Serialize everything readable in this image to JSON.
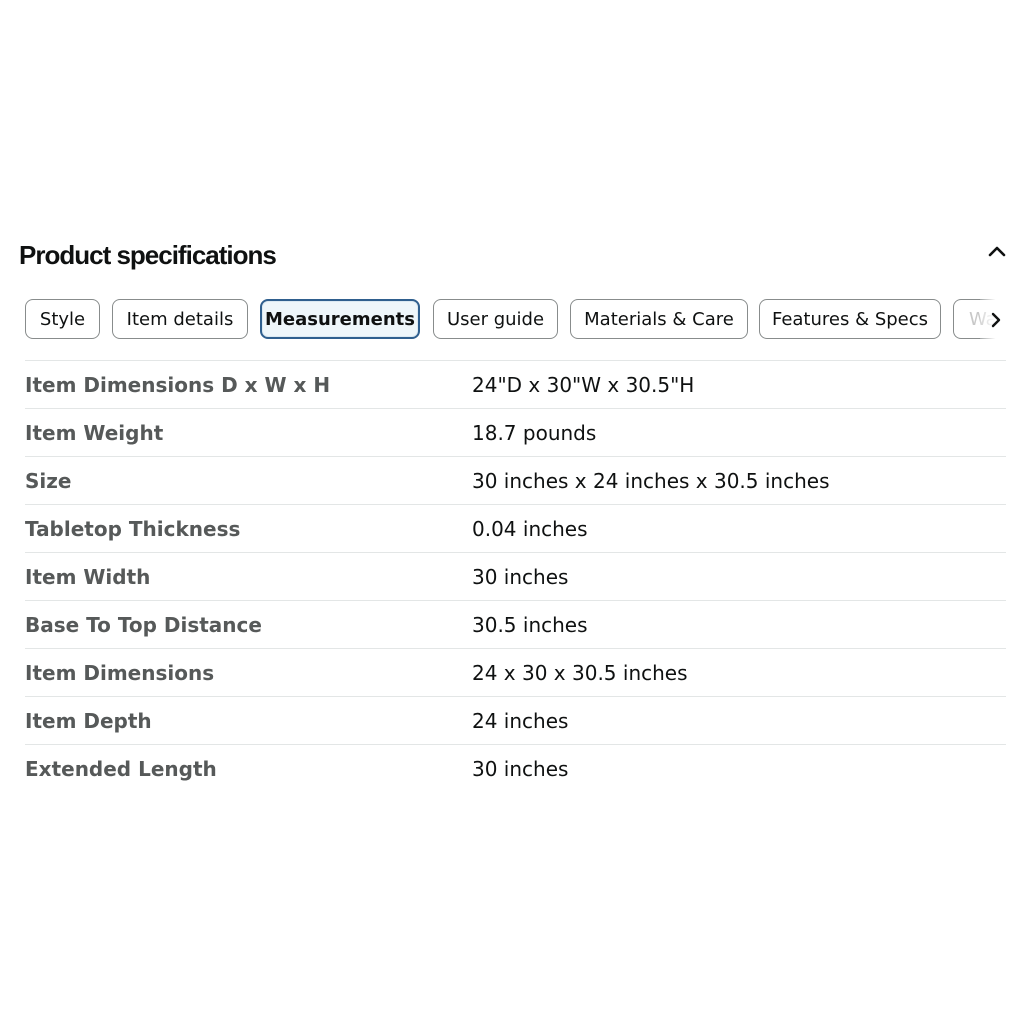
{
  "heading": "Product specifications",
  "tabs": [
    {
      "label": "Style",
      "active": false
    },
    {
      "label": "Item details",
      "active": false
    },
    {
      "label": "Measurements",
      "active": true
    },
    {
      "label": "User guide",
      "active": false
    },
    {
      "label": "Materials & Care",
      "active": false
    },
    {
      "label": "Features & Specs",
      "active": false
    },
    {
      "label": "Wa",
      "active": false
    }
  ],
  "specs": [
    {
      "label": "Item Dimensions D x W x H",
      "value": "24\"D x 30\"W x 30.5\"H"
    },
    {
      "label": "Item Weight",
      "value": "18.7 pounds"
    },
    {
      "label": "Size",
      "value": "30 inches x 24 inches x 30.5 inches"
    },
    {
      "label": "Tabletop Thickness",
      "value": "0.04 inches"
    },
    {
      "label": "Item Width",
      "value": "30 inches"
    },
    {
      "label": "Base To Top Distance",
      "value": "30.5 inches"
    },
    {
      "label": "Item Dimensions",
      "value": "24 x 30 x 30.5 inches"
    },
    {
      "label": "Item Depth",
      "value": "24 inches"
    },
    {
      "label": "Extended Length",
      "value": "30 inches"
    }
  ],
  "icons": {
    "collapse": "chevron-up-icon",
    "scroll": "chevron-right-icon"
  },
  "colors": {
    "active_border": "#2f5f8e",
    "active_background": "#eef6fa",
    "label_text": "#565959",
    "value_text": "#0f1111",
    "divider": "#e3e6e6"
  }
}
